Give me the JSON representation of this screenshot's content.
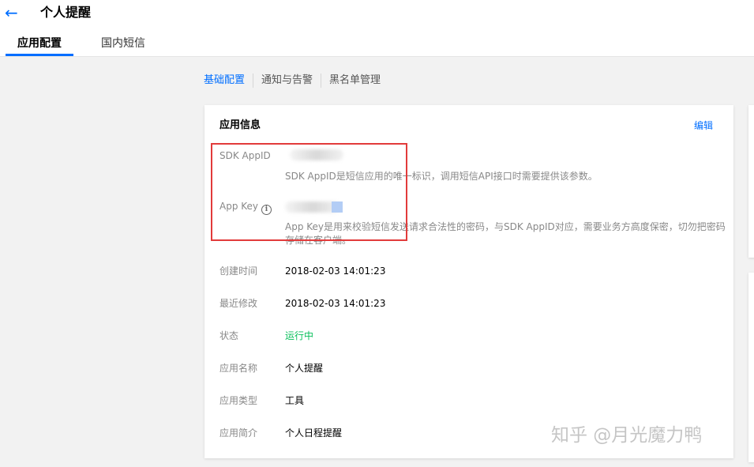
{
  "header": {
    "back_icon": "←",
    "title": "个人提醒",
    "tabs": [
      {
        "label": "应用配置",
        "active": true
      },
      {
        "label": "国内短信",
        "active": false
      }
    ]
  },
  "subnav": {
    "items": [
      {
        "label": "基础配置",
        "active": true
      },
      {
        "label": "通知与告警",
        "active": false
      },
      {
        "label": "黑名单管理",
        "active": false
      }
    ]
  },
  "card": {
    "title": "应用信息",
    "edit_label": "编辑",
    "sdk_appid": {
      "label": "SDK AppID",
      "description": "SDK AppID是短信应用的唯一标识，调用短信API接口时需要提供该参数。"
    },
    "app_key": {
      "label": "App Key",
      "description_line1": "App Key是用来校验短信发送请求合法性的密码，与SDK AppID对应，需要业务方高度保密，切勿把密码",
      "description_line2": "存储在客户端。"
    },
    "created_time": {
      "label": "创建时间",
      "value": "2018-02-03 14:01:23"
    },
    "modified_time": {
      "label": "最近修改",
      "value": "2018-02-03 14:01:23"
    },
    "status": {
      "label": "状态",
      "value": "运行中"
    },
    "app_name": {
      "label": "应用名称",
      "value": "个人提醒"
    },
    "app_type": {
      "label": "应用类型",
      "value": "工具"
    },
    "app_intro": {
      "label": "应用简介",
      "value": "个人日程提醒"
    }
  },
  "watermark": "知乎 @月光魔力鸭",
  "colors": {
    "accent": "#006eff",
    "status_running": "#0abf5b",
    "highlight_box": "#e23b3b"
  }
}
